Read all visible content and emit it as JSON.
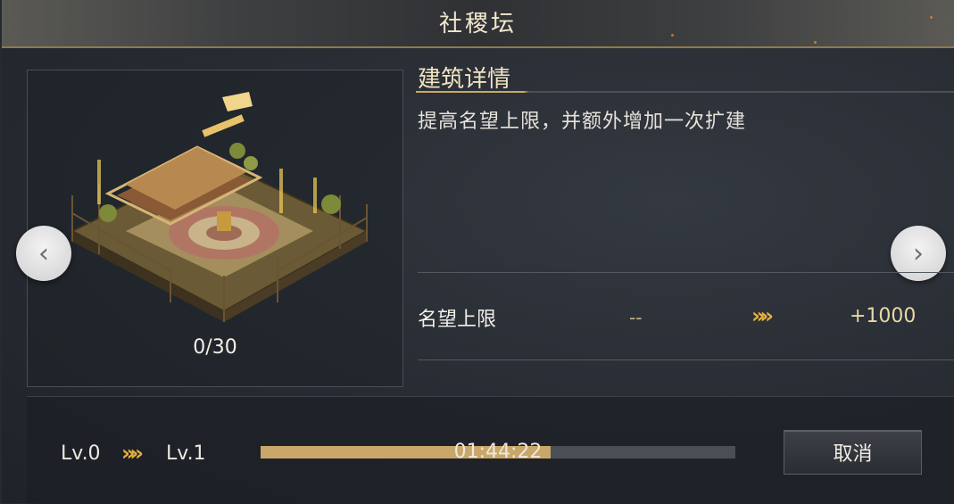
{
  "window": {
    "title": "社稷坛"
  },
  "building": {
    "progress_count": "0/30"
  },
  "nav": {
    "prev_symbol": "‹",
    "next_symbol": "›"
  },
  "details": {
    "section_title": "建筑详情",
    "description": "提高名望上限，并额外增加一次扩建"
  },
  "stat": {
    "label": "名望上限",
    "current": "--",
    "arrow": "»»",
    "next": "+1000"
  },
  "upgrade": {
    "from_level": "Lv.0",
    "arrow": "»»",
    "to_level": "Lv.1",
    "timer": "01:44:22",
    "progress_fraction": 0.61,
    "cancel_label": "取消"
  },
  "colors": {
    "accent_gold": "#e6b23a",
    "progress_fill": "#c9a76a",
    "progress_track": "#4a4e55"
  }
}
